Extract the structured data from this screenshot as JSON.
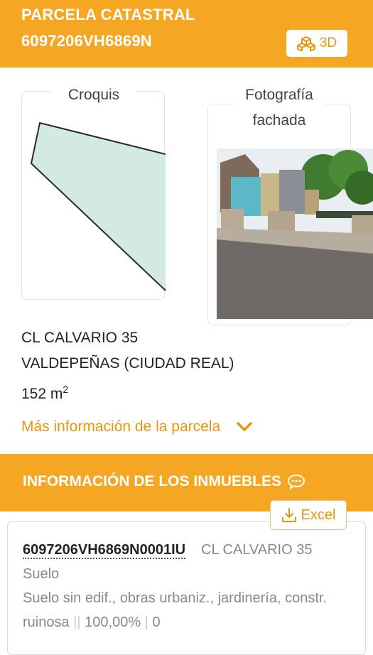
{
  "header": {
    "title_line1": "PARCELA CATASTRAL",
    "title_line2": "6097206VH6869N",
    "btn_3d_label": "3D"
  },
  "sketch": {
    "label": "Croquis"
  },
  "photo": {
    "label": "Fotografía fachada"
  },
  "address": {
    "line1": "CL CALVARIO 35",
    "line2": "VALDEPEÑAS (CIUDAD REAL)",
    "area_value": "152 m",
    "area_exp": "2"
  },
  "more_info": {
    "label": "Más información de la parcela"
  },
  "properties": {
    "title": "INFORMACIÓN DE LOS INMUEBLES",
    "excel_label": "Excel",
    "items": [
      {
        "ref": "6097206VH6869N0001IU",
        "address": "CL CALVARIO 35 Suelo",
        "use": "Suelo sin edif., obras urbaniz., jardinería, constr. ruinosa",
        "sep": "|",
        "participation": "100,00%",
        "year": "0"
      }
    ]
  },
  "colors": {
    "brand": "#f5a623",
    "accent_text": "#e8950e",
    "parcel_fill": "#d3e9e3"
  }
}
